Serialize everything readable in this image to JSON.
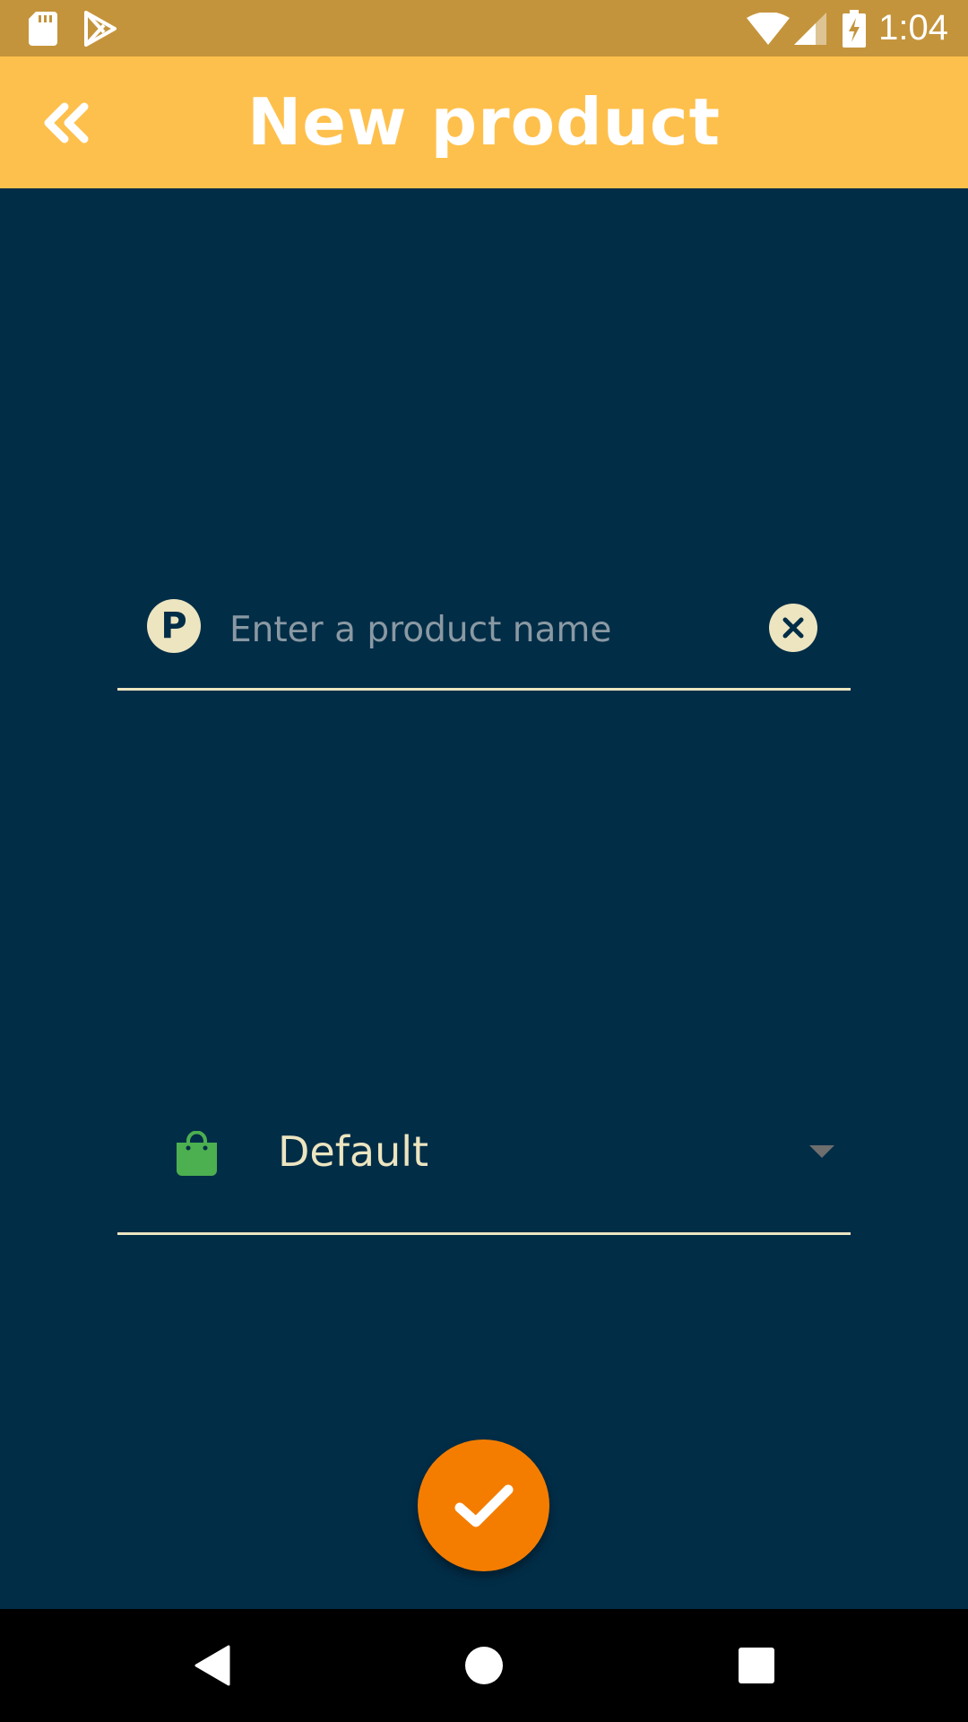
{
  "status_bar": {
    "time": "1:04",
    "icons": [
      "sd-card-icon",
      "play-store-icon",
      "wifi-icon",
      "signal-icon",
      "battery-charging-icon"
    ]
  },
  "app_bar": {
    "title": "New product",
    "back_icon": "double-chevron-left-icon"
  },
  "product_name_field": {
    "prefix_icon": "p-circle-icon",
    "prefix_letter": "P",
    "value": "",
    "placeholder": "Enter a product name",
    "clear_icon": "clear-circle-icon"
  },
  "category_dropdown": {
    "icon": "shopping-bag-icon",
    "selected_value": "Default",
    "arrow_icon": "dropdown-arrow-icon"
  },
  "fab": {
    "icon": "checkmark-icon"
  },
  "nav_bar": {
    "buttons": [
      "back-triangle-icon",
      "home-circle-icon",
      "recents-square-icon"
    ]
  },
  "colors": {
    "background": "#022d47",
    "status_bar": "#c4943c",
    "app_bar": "#fec04c",
    "accent_text": "#ece5c0",
    "fab": "#f47d00",
    "bag_icon": "#4caf50"
  }
}
